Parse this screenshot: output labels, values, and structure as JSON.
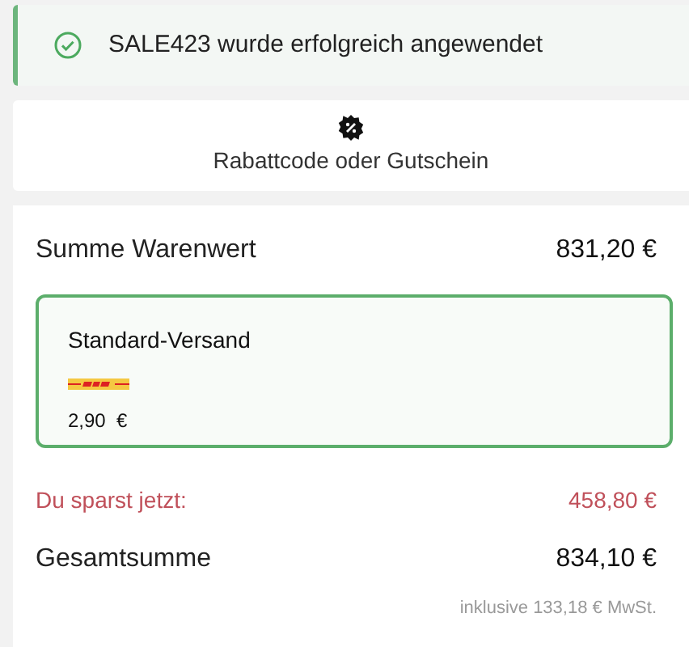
{
  "alert": {
    "message": "SALE423 wurde erfolgreich angewendet"
  },
  "coupon": {
    "label": "Rabattcode oder Gutschein"
  },
  "summary": {
    "subtotal_label": "Summe Warenwert",
    "subtotal": "831,20 €",
    "shipping_options": [
      {
        "name": "Standard-Versand",
        "price": "2,90  €",
        "selected": true
      }
    ],
    "savings_label": "Du sparst jetzt:",
    "savings": "458,80 €",
    "total_label": "Gesamtsumme",
    "total": "834,10 €",
    "tax_note": "inklusive 133,18 € MwSt."
  }
}
